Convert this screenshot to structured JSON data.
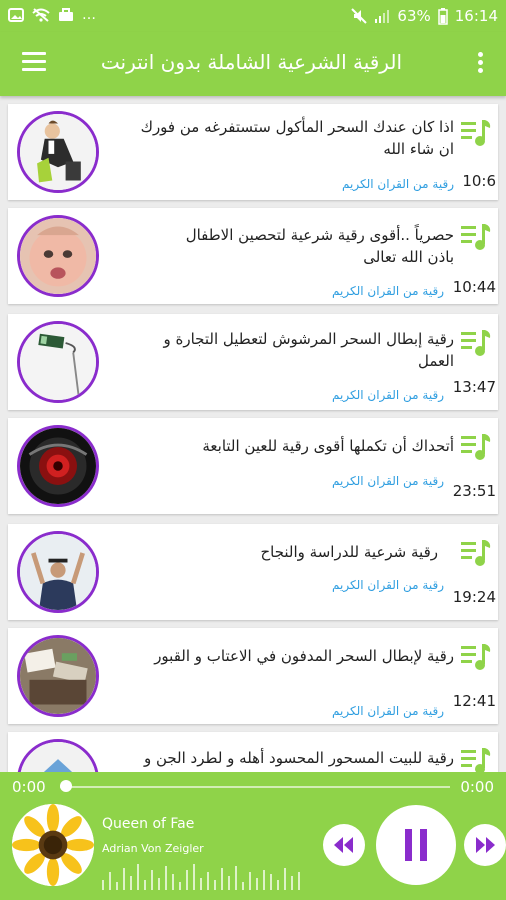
{
  "status_bar": {
    "battery": "63%",
    "time": "16:14",
    "left_icons": [
      "image-icon",
      "wifi-off-icon",
      "briefcase-icon",
      "more-dots-icon"
    ],
    "right_icons": [
      "mute-icon",
      "signal-icon",
      "battery-icon"
    ]
  },
  "app_bar": {
    "title": "الرقية الشرعية الشاملة بدون انترنت",
    "menu_icon": "hamburger-menu-icon",
    "more_icon": "overflow-menu-icon"
  },
  "items": [
    {
      "title_line1": "اذا كان عندك السحر المأكول ستستفرغه من فورك",
      "title_line2": "ان شاء الله",
      "subtitle": "رقية من القران الكريم",
      "duration": "10:6"
    },
    {
      "title_line1": "حصرياً ..أقوى رقية شرعية لتحصين الاطفال",
      "title_line2": "باذن الله تعالى",
      "subtitle": "رقية من القران الكريم",
      "duration": "10:44"
    },
    {
      "title_line1": "رقية إبطال السحر المرشوش لتعطيل التجارة و",
      "title_line2": "العمل",
      "subtitle": "رقية من القران الكريم",
      "duration": "13:47"
    },
    {
      "title_line1": "أتحداك أن تكملها أقوى رقية للعين التابعة",
      "title_line2": "",
      "subtitle": "رقية من القران الكريم",
      "duration": "23:51"
    },
    {
      "title_line1": "رقية شرعية للدراسة والنجاح",
      "title_line2": "",
      "subtitle": "رقية من القران الكريم",
      "duration": "19:24"
    },
    {
      "title_line1": "رقية لإبطال السحر المدفون في الاعتاب و القبور",
      "title_line2": "",
      "subtitle": "رقية من القران الكريم",
      "duration": "12:41"
    },
    {
      "title_line1": "رقية للبيت المسحور المحسود أهله و لطرد الجن و",
      "title_line2": "",
      "subtitle": "",
      "duration": ""
    }
  ],
  "player": {
    "elapsed": "0:00",
    "total": "0:00",
    "progress": 0,
    "track_title": "Queen of Fae",
    "artist": "Adrian Von Zeigler",
    "controls": [
      "rewind-icon",
      "pause-icon",
      "fast-forward-icon"
    ]
  },
  "colors": {
    "accent_green": "#8fd349",
    "avatar_border_purple": "#8a2ccc",
    "subtitle_blue": "#2f9ee0",
    "control_purple": "#8a2ccc"
  }
}
